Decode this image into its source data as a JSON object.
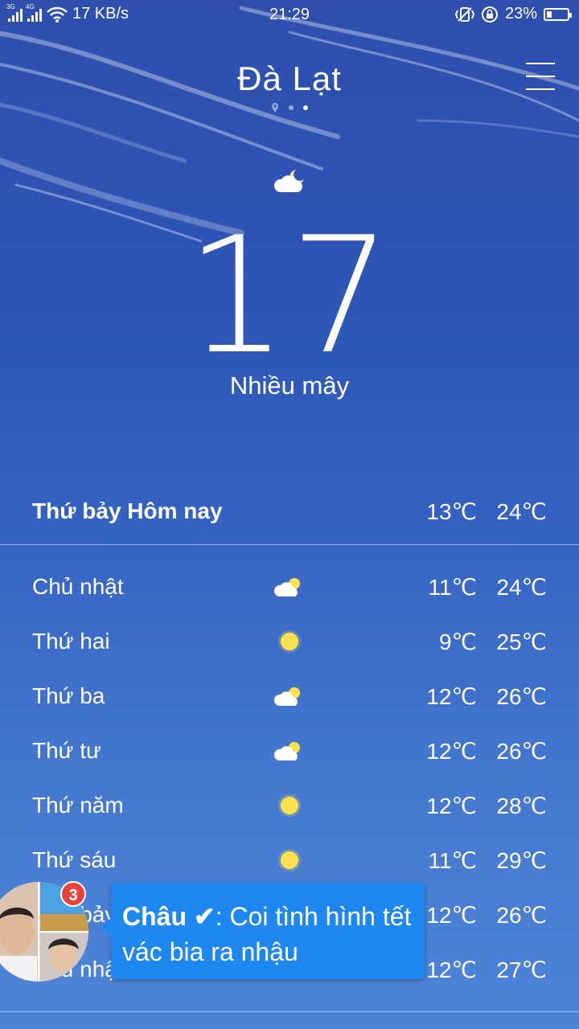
{
  "status_bar": {
    "network_1": "3G",
    "network_2": "4G",
    "speed": "17 KB/s",
    "time": "21:29",
    "battery_percent": "23%",
    "battery_level": 0.23,
    "icons": [
      "signal-icon",
      "wifi-icon",
      "vibrate-icon",
      "rotation-lock-icon",
      "battery-icon"
    ]
  },
  "header": {
    "city": "Đà Lạt",
    "page_count": 3,
    "active_page": 2
  },
  "current": {
    "icon": "partly-cloudy-night-icon",
    "temperature": "17",
    "condition": "Nhiều mây"
  },
  "today": {
    "day": "Thứ bảy  Hôm nay",
    "low": "13℃",
    "high": "24℃"
  },
  "forecast": [
    {
      "day": "Chủ nhật",
      "icon": "partly-cloudy",
      "low": "11℃",
      "high": "24℃"
    },
    {
      "day": "Thứ hai",
      "icon": "sunny",
      "low": "9℃",
      "high": "25℃"
    },
    {
      "day": "Thứ ba",
      "icon": "partly-cloudy",
      "low": "12℃",
      "high": "26℃"
    },
    {
      "day": "Thứ tư",
      "icon": "partly-cloudy",
      "low": "12℃",
      "high": "26℃"
    },
    {
      "day": "Thứ năm",
      "icon": "sunny",
      "low": "12℃",
      "high": "28℃"
    },
    {
      "day": "Thứ sáu",
      "icon": "sunny",
      "low": "11℃",
      "high": "29℃"
    },
    {
      "day": "Thứ bảy",
      "icon": "partly-cloudy",
      "low": "12℃",
      "high": "26℃"
    },
    {
      "day": "Chủ nhật",
      "icon": "partly-cloudy",
      "low": "12℃",
      "high": "27℃"
    }
  ],
  "chat_head": {
    "badge_count": "3",
    "sender": "Châu ✔",
    "message": "Coi tình hình tết vác bia ra nhậu"
  },
  "colors": {
    "background_top": "#2e4fae",
    "background_bottom": "#4e85d8",
    "bubble": "#1e88f0",
    "badge": "#e8443b",
    "sun": "#fde24f"
  }
}
